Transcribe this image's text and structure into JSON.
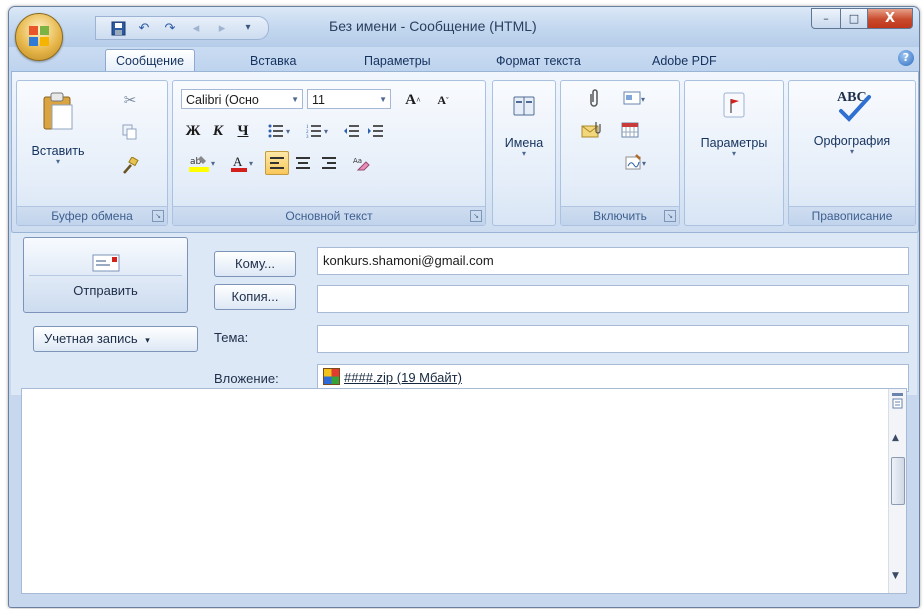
{
  "window": {
    "title": "Без имени - Сообщение (HTML)",
    "controls": {
      "minimize": "–",
      "maximize": "□",
      "close": "X"
    }
  },
  "quick_access": {
    "save_icon": "save-icon",
    "undo_icon": "undo-icon",
    "redo_icon": "redo-icon"
  },
  "tabs": [
    "Сообщение",
    "Вставка",
    "Параметры",
    "Формат текста",
    "Adobe PDF"
  ],
  "active_tab": "Сообщение",
  "ribbon": {
    "clipboard": {
      "paste_label": "Вставить",
      "group_label": "Буфер обмена"
    },
    "basic_text": {
      "font_name": "Calibri (Осно",
      "font_size": "11",
      "bold": "Ж",
      "italic": "К",
      "underline": "Ч",
      "grow_font": "A",
      "shrink_font": "A",
      "group_label": "Основной текст"
    },
    "names": {
      "label": "Имена"
    },
    "include": {
      "group_label": "Включить"
    },
    "options": {
      "label": "Параметры"
    },
    "proofing": {
      "spelling_label": "Орфография",
      "group_label": "Правописание",
      "abc": "ABC"
    }
  },
  "compose": {
    "send_label": "Отправить",
    "to_button": "Кому...",
    "cc_button": "Копия...",
    "account_button": "Учетная запись",
    "subject_label": "Тема:",
    "attachment_label": "Вложение:",
    "to_value": "konkurs.shamoni@gmail.com",
    "cc_value": "",
    "subject_value": "",
    "attachment_name": "####.zip (19 Мбайт)"
  },
  "colors": {
    "accent": "#c4d8ef",
    "highlight": "#f9c85a",
    "font_red": "#d4201b"
  }
}
